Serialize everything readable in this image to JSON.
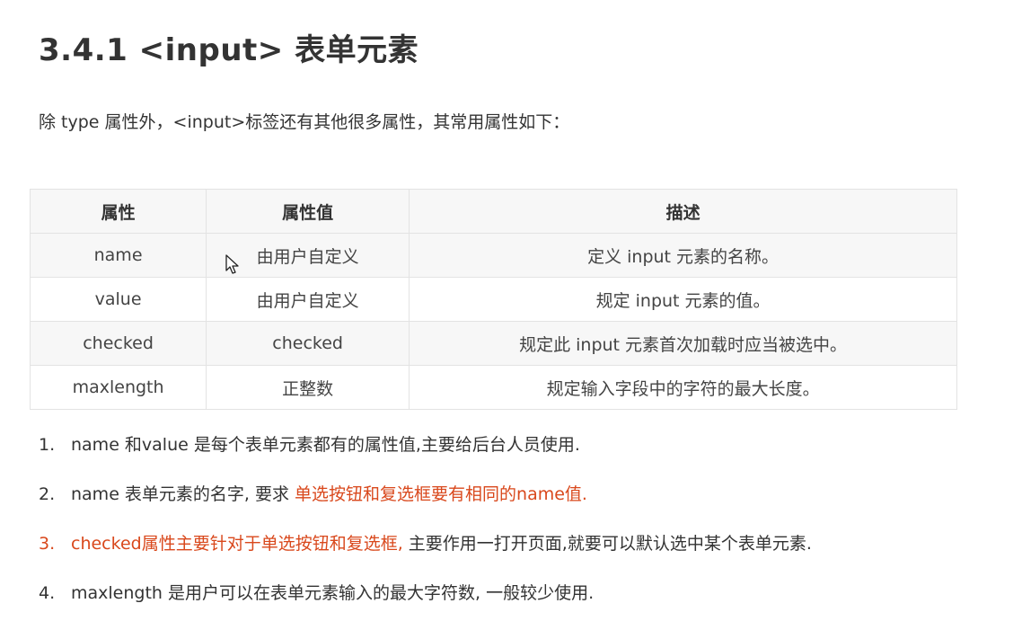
{
  "heading": "3.4.1 <input> 表单元素",
  "intro": "除 type 属性外，<input>标签还有其他很多属性，其常用属性如下：",
  "table": {
    "headers": [
      "属性",
      "属性值",
      "描述"
    ],
    "rows": [
      [
        "name",
        "由用户自定义",
        "定义 input 元素的名称。"
      ],
      [
        "value",
        "由用户自定义",
        "规定 input 元素的值。"
      ],
      [
        "checked",
        "checked",
        "规定此 input 元素首次加载时应当被选中。"
      ],
      [
        "maxlength",
        "正整数",
        "规定输入字段中的字符的最大长度。"
      ]
    ]
  },
  "notes": [
    {
      "num": "1.",
      "text": "name 和value 是每个表单元素都有的属性值,主要给后台人员使用."
    },
    {
      "num": "2.",
      "prefix": "name 表单元素的名字, 要求 ",
      "highlight": "单选按钮和复选框要有相同的name值."
    },
    {
      "num": "3.",
      "highlight": "checked属性主要针对于单选按钮和复选框,",
      "suffix": " 主要作用一打开页面,就要可以默认选中某个表单元素."
    },
    {
      "num": "4.",
      "text": "maxlength 是用户可以在表单元素输入的最大字符数, 一般较少使用."
    }
  ],
  "colors": {
    "text": "#333333",
    "highlight": "#d9481c",
    "table_border": "#e3e3e3",
    "table_stripe": "#f7f7f7"
  },
  "icons": {
    "cursor": "mouse-pointer-icon"
  }
}
